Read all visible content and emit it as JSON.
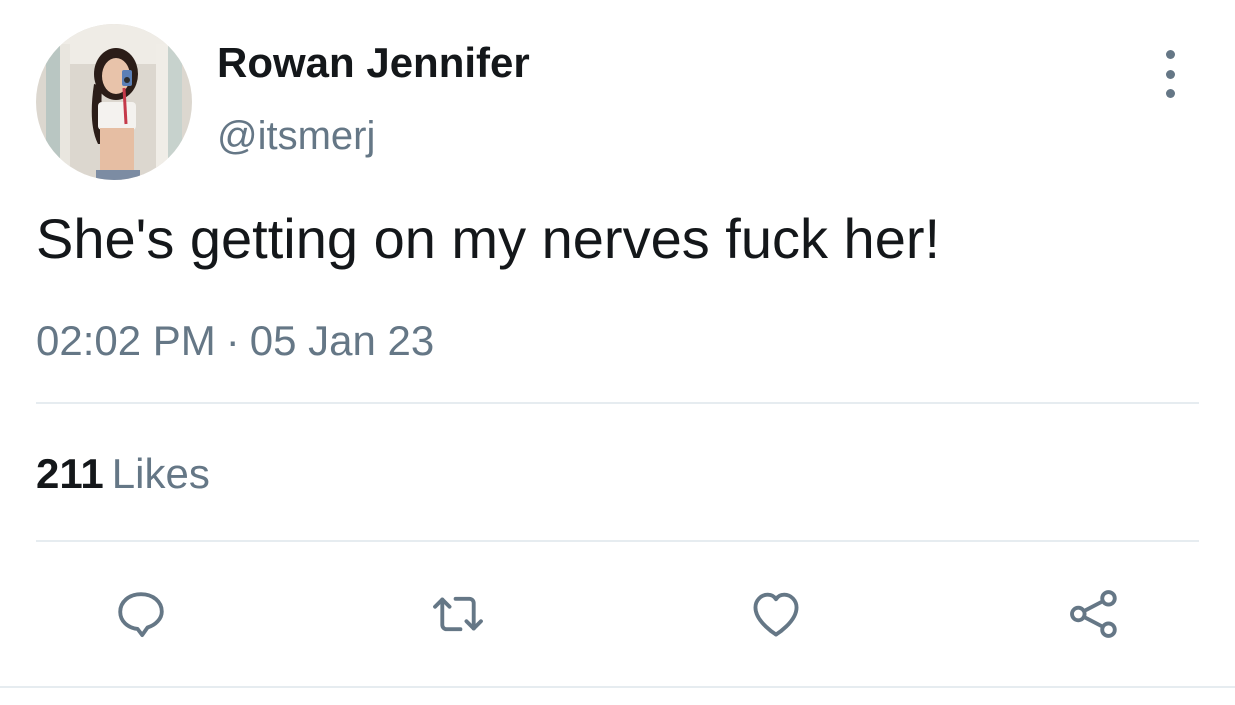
{
  "tweet": {
    "display_name": "Rowan Jennifer",
    "handle": "@itsmerj",
    "text": "She's getting on my nerves fuck her!",
    "time": "02:02 PM",
    "separator": "·",
    "date": "05 Jan 23",
    "likes_count": "211",
    "likes_label": "Likes"
  },
  "icons": {
    "avatar": "profile-photo",
    "more": "more-vertical-icon",
    "reply": "reply-icon",
    "retweet": "retweet-icon",
    "like": "heart-icon",
    "share": "share-icon"
  },
  "colors": {
    "text_primary": "#14171a",
    "text_secondary": "#657786",
    "divider": "#e6ecf0",
    "background": "#ffffff"
  }
}
